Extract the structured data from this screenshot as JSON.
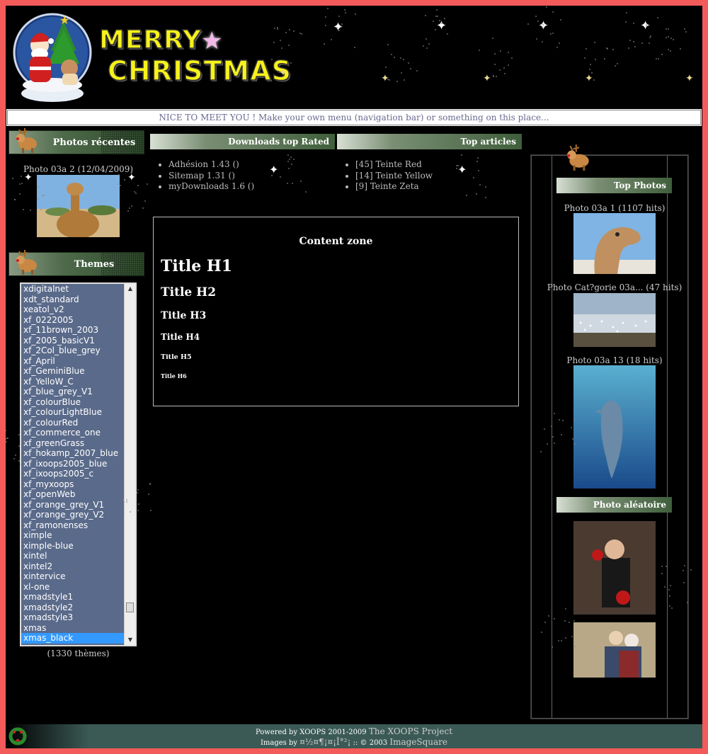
{
  "header": {
    "logo_line1": "MERRY",
    "logo_line2": "CHRISTMAS"
  },
  "navbar": {
    "text": "NICE TO MEET YOU ! Make your own menu (navigation bar) or something on this place..."
  },
  "left": {
    "recent_photos": {
      "title": "Photos récentes",
      "caption": "Photo 03a 2 (12/04/2009)"
    },
    "themes": {
      "title": "Themes",
      "options": [
        "xdigitalnet",
        "xdt_standard",
        "xeatol_v2",
        "xf_0222005",
        "xf_11brown_2003",
        "xf_2005_basicV1",
        "xf_2Col_blue_grey",
        "xf_April",
        "xf_GeminiBlue",
        "xf_YelloW_C",
        "xf_blue_grey_V1",
        "xf_colourBlue",
        "xf_colourLightBlue",
        "xf_colourRed",
        "xf_commerce_one",
        "xf_greenGrass",
        "xf_hokamp_2007_blue",
        "xf_ixoops2005_blue",
        "xf_ixoops2005_c",
        "xf_myxoops",
        "xf_openWeb",
        "xf_orange_grey_V1",
        "xf_orange_grey_V2",
        "xf_ramonenses",
        "ximple",
        "ximple-blue",
        "xintel",
        "xintel2",
        "xintervice",
        "xl-one",
        "xmadstyle1",
        "xmadstyle2",
        "xmadstyle3",
        "xmas",
        "xmas_black"
      ],
      "selected": "xmas_black",
      "count": "(1330 thèmes)"
    }
  },
  "center": {
    "downloads": {
      "title": "Downloads top Rated",
      "items": [
        "Adhésion 1.43 ()",
        "Sitemap 1.31 ()",
        "myDownloads 1.6 ()"
      ]
    },
    "articles": {
      "title": "Top articles",
      "items": [
        "[45] Teinte Red",
        "[14] Teinte Yellow",
        "[9] Teinte Zeta"
      ]
    },
    "content": {
      "title": "Content zone",
      "h1": "Title H1",
      "h2": "Title H2",
      "h3": "Title H3",
      "h4": "Title H4",
      "h5": "Title H5",
      "h6": "Title H6"
    }
  },
  "right": {
    "top_photos": {
      "title": "Top Photos",
      "captions": [
        "Photo 03a 1 (1107 hits)",
        "Photo Cat?gorie 03a... (47 hits)",
        "Photo 03a 13 (18 hits)"
      ]
    },
    "random_photo": {
      "title": "Photo aléatoire"
    }
  },
  "footer": {
    "powered": "Powered by XOOPS 2001-2009",
    "project": "The XOOPS Project",
    "images_by": "Images by",
    "images_author": "¤½¤¶¡¤¡Î°²¡",
    "copyright": ":: © 2003",
    "imagesquare": "ImageSquare"
  },
  "colors": {
    "page_border": "#f35a5a",
    "background": "#000000",
    "block_green": "#3f5e3b",
    "footer_teal": "#3b5a55",
    "select_highlight": "#3399ff",
    "themes_list_bg": "#5a6a8a",
    "logo_yellow": "#f7f21a"
  }
}
